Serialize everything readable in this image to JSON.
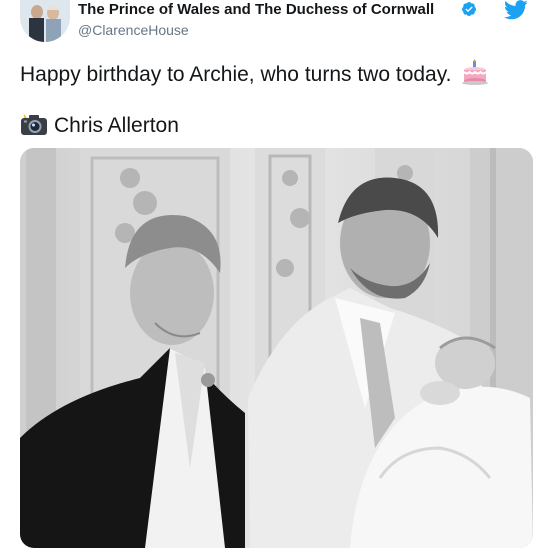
{
  "tweet": {
    "display_name": "The Prince of Wales and The Duchess of Cornwall",
    "handle": "@ClarenceHouse",
    "text": "Happy birthday to Archie, who turns two today.",
    "credit": "Chris Allerton"
  },
  "icons": {
    "avatar": "profile-photo",
    "verified": "verified-badge-icon",
    "logo": "twitter-bird-icon",
    "cake": "birthday-cake-emoji",
    "camera": "camera-with-flash-emoji"
  },
  "colors": {
    "text": "#14171a",
    "handle": "#657786",
    "brand_blue": "#1da1f2"
  }
}
